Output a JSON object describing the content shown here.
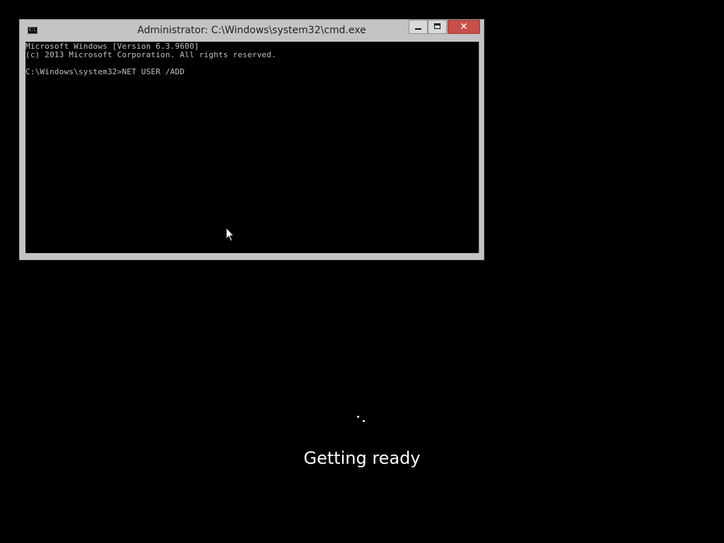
{
  "window": {
    "title": "Administrator: C:\\Windows\\system32\\cmd.exe",
    "icon_text": "C:\\.",
    "close_label": "✕"
  },
  "console": {
    "lines": [
      "Microsoft Windows [Version 6.3.9600]",
      "(c) 2013 Microsoft Corporation. All rights reserved.",
      "",
      "C:\\Windows\\system32>NET USER /ADD"
    ]
  },
  "setup": {
    "status": "Getting ready"
  },
  "colors": {
    "desktop_background": "#000000",
    "window_frame": "#c4c4c4",
    "close_button": "#c7504b",
    "console_text": "#c0c0c0",
    "status_text": "#ffffff"
  },
  "icons": {
    "app": "cmd-icon",
    "minimize": "minimize-icon",
    "maximize": "maximize-icon",
    "close": "close-icon",
    "pointer": "mouse-pointer-icon",
    "spinner": "loading-spinner-icon"
  }
}
